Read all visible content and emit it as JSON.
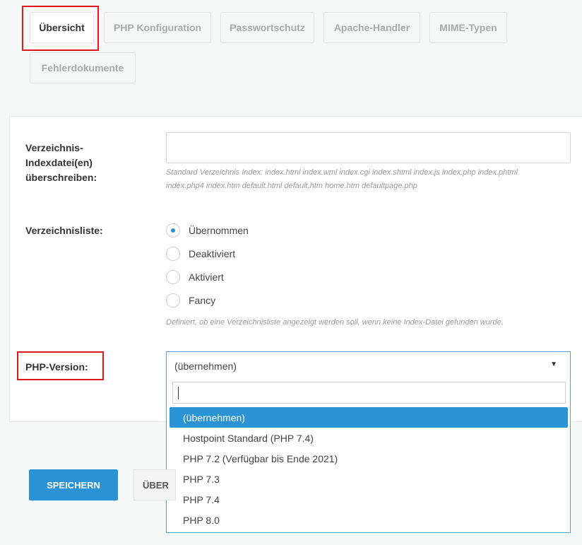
{
  "tabs": [
    {
      "label": "Übersicht",
      "active": true
    },
    {
      "label": "PHP Konfiguration",
      "active": false
    },
    {
      "label": "Passwortschutz",
      "active": false
    },
    {
      "label": "Apache-Handler",
      "active": false
    },
    {
      "label": "MIME-Typen",
      "active": false
    },
    {
      "label": "Fehlerdokumente",
      "active": false
    }
  ],
  "index_files": {
    "label": "Verzeichnis-\nIndexdatei(en)\nüberschreiben:",
    "value": "",
    "help_line1": "Standard Verzeichnis Index: index.html index.wml index.cgi index.shtml index.js index.php index.phtml",
    "help_line2": "index.php4 index.htm default.html default.htm home.htm defaultpage.php"
  },
  "dir_listing": {
    "label": "Verzeichnisliste:",
    "options": [
      "Übernommen",
      "Deaktiviert",
      "Aktiviert",
      "Fancy"
    ],
    "selected": "Übernommen",
    "help": "Definiert, ob eine Verzeichnisliste angezeigt werden soll, wenn keine Index-Datei gefunden wurde."
  },
  "php_version": {
    "label": "PHP-Version:",
    "selected": "(übernehmen)",
    "search_value": "",
    "options": [
      "(übernehmen)",
      "Hostpoint Standard (PHP 7.4)",
      "PHP 7.2 (Verfügbar bis Ende 2021)",
      "PHP 7.3",
      "PHP 7.4",
      "PHP 8.0"
    ]
  },
  "buttons": {
    "save": "SPEICHERN",
    "back_partial": "ÜBER"
  },
  "colors": {
    "accent": "#2a93d5",
    "highlight": "#e2161d"
  }
}
